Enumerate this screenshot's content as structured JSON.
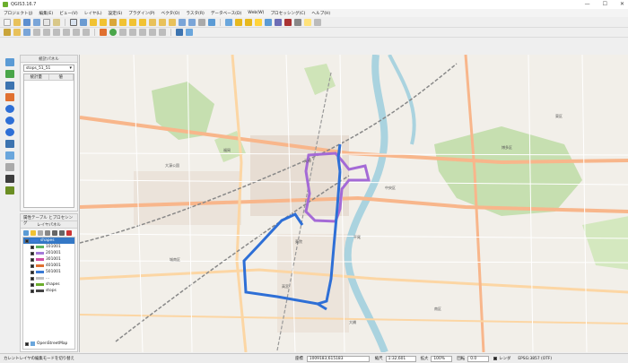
{
  "window": {
    "title": "QGIS3.16.7",
    "controls": [
      "—",
      "☐",
      "✕"
    ]
  },
  "menu": [
    "プロジェクト(J)",
    "編集(E)",
    "ビュー(V)",
    "レイヤ(L)",
    "設定(S)",
    "プラグイン(P)",
    "ベクタ(O)",
    "ラスタ(R)",
    "データベース(D)",
    "Web(W)",
    "プロセッシング(C)",
    "ヘルプ(H)"
  ],
  "stats_panel": {
    "title": "統計パネル",
    "layer_value": "stops_51_51",
    "column_stat": "統計量",
    "column_value": "値"
  },
  "layers_panel": {
    "tabs_label": "属性テーブル とプロセシング",
    "title": "レイヤパネル",
    "layers": [
      {
        "name": "shapes",
        "color": "#3a7ad4",
        "checked": true,
        "selected": true
      },
      {
        "name": "101001",
        "color": "#5fb55f",
        "checked": true
      },
      {
        "name": "201001",
        "color": "#a47ad8",
        "checked": true
      },
      {
        "name": "301001",
        "color": "#d24ea4",
        "checked": true
      },
      {
        "name": "401001",
        "color": "#e07030",
        "checked": true
      },
      {
        "name": "501001",
        "color": "#3a7ad4",
        "checked": true
      },
      {
        "name": "...",
        "color": "#c0c0c0",
        "checked": true
      },
      {
        "name": "shapes",
        "color": "#6cae2d",
        "checked": true
      },
      {
        "name": "stops",
        "color": "#444444",
        "checked": true
      }
    ],
    "basemap": "OpenStreetMap"
  },
  "map": {
    "labels": [
      "福岡",
      "中央区",
      "博多区",
      "城南区",
      "南区",
      "東区",
      "大濠公園",
      "天神",
      "薬院",
      "平尾",
      "高宮",
      "大橋"
    ],
    "route_colors": {
      "purple": "#a46ad6",
      "blue": "#2e6fd6"
    }
  },
  "status": {
    "hint": "カレントレイヤの編集モードを切り替え",
    "coord_label": "座標",
    "coord_value": "1009183,615183",
    "scale_label": "縮尺",
    "scale_value": "1:32,601",
    "magnifier_label": "拡大",
    "magnifier_value": "100%",
    "rotation_label": "回転",
    "rotation_value": "0.0",
    "render_label": "レンダ",
    "crs": "EPSG:3857 (OTF)"
  }
}
